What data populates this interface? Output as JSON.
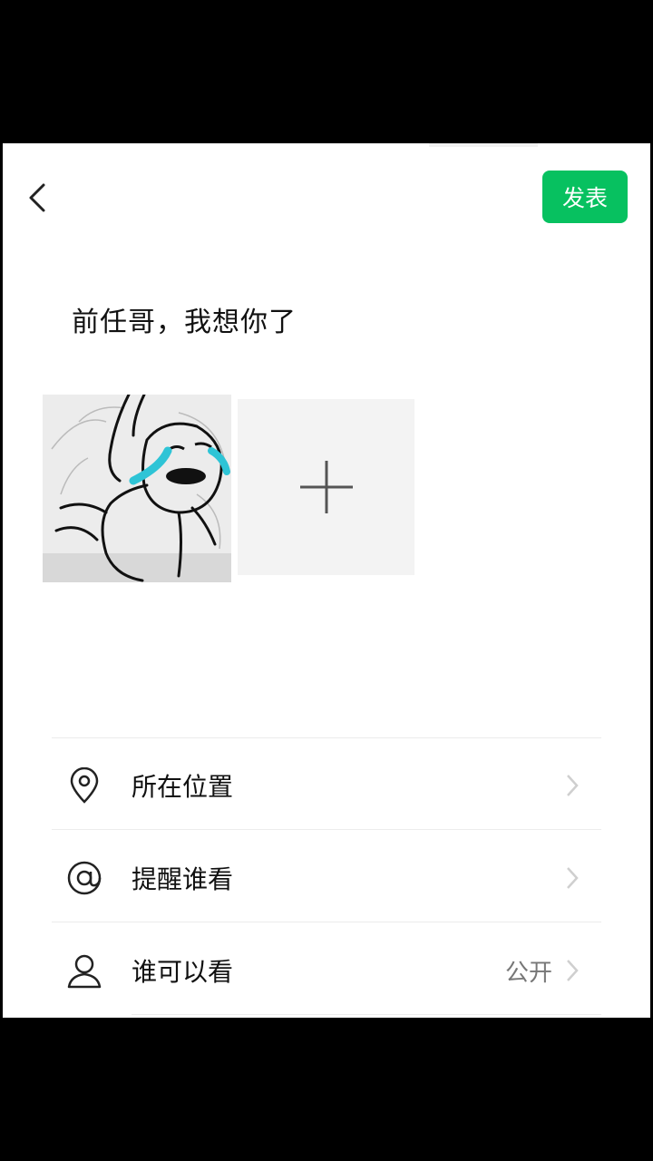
{
  "header": {
    "back_icon": "chevron-left-icon",
    "post_label": "发表",
    "accent_color": "#07c160"
  },
  "composer": {
    "text": "前任哥，我想你了",
    "photos": [
      {
        "description_icon": "crying-meme-sketch"
      }
    ],
    "add_photo_icon": "plus-icon"
  },
  "options": [
    {
      "icon": "location-pin-icon",
      "label": "所在位置",
      "value": ""
    },
    {
      "icon": "at-sign-icon",
      "label": "提醒谁看",
      "value": ""
    },
    {
      "icon": "person-icon",
      "label": "谁可以看",
      "value": "公开"
    }
  ]
}
